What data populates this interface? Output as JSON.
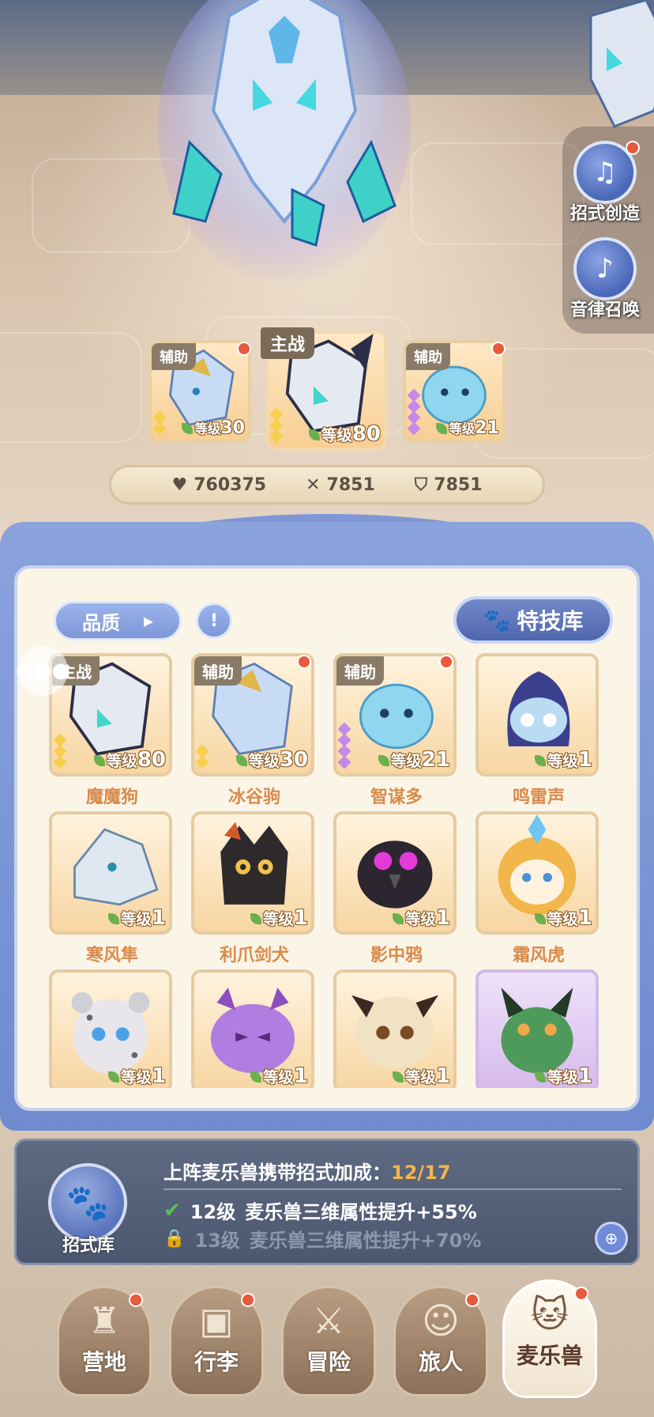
{
  "side_buttons": [
    {
      "label": "招式创造",
      "icon": "skill-create-icon",
      "badge": true
    },
    {
      "label": "音律召唤",
      "icon": "lyre-icon",
      "badge": false
    }
  ],
  "team": [
    {
      "role": "辅助",
      "level_prefix": "等级",
      "level": "30",
      "badge": true,
      "stars": 2
    },
    {
      "role": "主战",
      "level_prefix": "等级",
      "level": "80",
      "badge": false,
      "stars": 3
    },
    {
      "role": "辅助",
      "level_prefix": "等级",
      "level": "21",
      "badge": true,
      "stars": 4
    }
  ],
  "stats": {
    "hp": "760375",
    "attack": "7851",
    "defense": "7851"
  },
  "toolbar": {
    "quality_label": "品质",
    "skill_library_label": "特技库"
  },
  "pets": [
    {
      "name": "魔魔狗",
      "tag": "主战",
      "level_prefix": "等级",
      "level": "80",
      "badge": false
    },
    {
      "name": "冰谷驹",
      "tag": "辅助",
      "level_prefix": "等级",
      "level": "30",
      "badge": true
    },
    {
      "name": "智谋多",
      "tag": "辅助",
      "level_prefix": "等级",
      "level": "21",
      "badge": true
    },
    {
      "name": "鸣雷声",
      "tag": "",
      "level_prefix": "等级",
      "level": "1",
      "badge": false
    },
    {
      "name": "寒风隼",
      "tag": "",
      "level_prefix": "等级",
      "level": "1",
      "badge": false
    },
    {
      "name": "利爪剑犬",
      "tag": "",
      "level_prefix": "等级",
      "level": "1",
      "badge": false
    },
    {
      "name": "影中鸦",
      "tag": "",
      "level_prefix": "等级",
      "level": "1",
      "badge": false
    },
    {
      "name": "霜风虎",
      "tag": "",
      "level_prefix": "等级",
      "level": "1",
      "badge": false
    },
    {
      "name": "",
      "tag": "",
      "level_prefix": "等级",
      "level": "1",
      "badge": false
    },
    {
      "name": "",
      "tag": "",
      "level_prefix": "等级",
      "level": "1",
      "badge": false
    },
    {
      "name": "",
      "tag": "",
      "level_prefix": "等级",
      "level": "1",
      "badge": false
    },
    {
      "name": "",
      "tag": "",
      "level_prefix": "等级",
      "level": "1",
      "badge": false
    }
  ],
  "bonus": {
    "icon_label": "招式库",
    "title": "上阵麦乐兽携带招式加成：",
    "progress": "12/17",
    "unlocked_level": "12级",
    "unlocked_text": "麦乐兽三维属性提升+55%",
    "locked_level": "13级",
    "locked_text": "麦乐兽三维属性提升+70%"
  },
  "nav": [
    {
      "label": "营地",
      "icon": "castle-icon",
      "badge": true,
      "active": false
    },
    {
      "label": "行李",
      "icon": "backpack-icon",
      "badge": true,
      "active": false
    },
    {
      "label": "冒险",
      "icon": "swords-icon",
      "badge": false,
      "active": false
    },
    {
      "label": "旅人",
      "icon": "traveler-icon",
      "badge": true,
      "active": false
    },
    {
      "label": "麦乐兽",
      "icon": "pet-cat-icon",
      "badge": true,
      "active": true
    }
  ]
}
